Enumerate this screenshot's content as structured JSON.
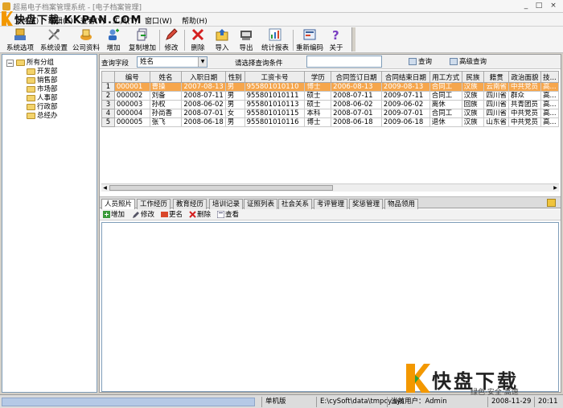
{
  "window": {
    "title": "超易电子档案管理系统 - [电子档案管理]",
    "controls": [
      "_",
      "□",
      "×"
    ]
  },
  "watermark": "快盘下载 KKPAN.COM",
  "menu": [
    "文件(F)",
    "编辑(E)",
    "查看(V)",
    "工具(T)",
    "窗口(W)",
    "帮助(H)"
  ],
  "toolbar": [
    {
      "label": "系统选项",
      "icon": "system-options-icon"
    },
    {
      "label": "系统设置",
      "icon": "tools-icon"
    },
    {
      "label": "公司资料",
      "icon": "company-icon"
    },
    {
      "label": "增加",
      "icon": "add-icon"
    },
    {
      "label": "复制增加",
      "icon": "copy-add-icon"
    },
    {
      "label": "修改",
      "icon": "edit-icon"
    },
    {
      "label": "删除",
      "icon": "delete-icon"
    },
    {
      "label": "导入",
      "icon": "import-icon"
    },
    {
      "label": "导出",
      "icon": "export-icon"
    },
    {
      "label": "统计报表",
      "icon": "report-icon"
    },
    {
      "label": "重新编码",
      "icon": "recode-icon"
    },
    {
      "label": "关于",
      "icon": "help-icon"
    }
  ],
  "tree": {
    "root": "所有分组",
    "children": [
      "开发部",
      "销售部",
      "市场部",
      "人事部",
      "行政部",
      "总经办"
    ]
  },
  "search": {
    "field_label": "查询字段",
    "field_value": "姓名",
    "condition_label": "请选择查询条件",
    "input_value": "",
    "query_button": "查询",
    "advanced_button": "高级查询"
  },
  "grid": {
    "columns": [
      "编号",
      "姓名",
      "入职日期",
      "性别",
      "工资卡号",
      "学历",
      "合同签订日期",
      "合同结束日期",
      "用工方式",
      "民族",
      "籍贯",
      "政治面貌",
      "技..."
    ],
    "rows": [
      {
        "num": "1",
        "cells": [
          "000001",
          "曹操",
          "2007-08-13",
          "男",
          "955801010110",
          "博士",
          "2006-08-13",
          "2009-08-13",
          "合同工",
          "汉族",
          "云南省",
          "中共党员",
          "高..."
        ],
        "selected": true
      },
      {
        "num": "2",
        "cells": [
          "000002",
          "刘备",
          "2008-07-11",
          "男",
          "955801010111",
          "硕士",
          "2008-07-11",
          "2009-07-11",
          "合同工",
          "汉族",
          "四川省",
          "群众",
          "高..."
        ],
        "selected": false
      },
      {
        "num": "3",
        "cells": [
          "000003",
          "孙权",
          "2008-06-02",
          "男",
          "955801010113",
          "硕士",
          "2008-06-02",
          "2009-06-02",
          "离休",
          "回族",
          "四川省",
          "共青团员",
          "高..."
        ],
        "selected": false
      },
      {
        "num": "4",
        "cells": [
          "000004",
          "孙尚香",
          "2008-07-01",
          "女",
          "955801010115",
          "本科",
          "2008-07-01",
          "2009-07-01",
          "合同工",
          "汉族",
          "四川省",
          "中共党员",
          "高..."
        ],
        "selected": false
      },
      {
        "num": "5",
        "cells": [
          "000005",
          "张飞",
          "2008-06-18",
          "男",
          "955801010116",
          "博士",
          "2008-06-18",
          "2009-06-18",
          "退休",
          "汉族",
          "山东省",
          "中共党员",
          "高..."
        ],
        "selected": false
      }
    ]
  },
  "tabs": [
    "人员照片",
    "工作经历",
    "教育经历",
    "培训记录",
    "证照列表",
    "社会关系",
    "考评管理",
    "奖惩管理",
    "物品领用"
  ],
  "active_tab": "人员照片",
  "subtoolbar": [
    "增加",
    "修改",
    "更名",
    "删除",
    "查看"
  ],
  "status": {
    "mode": "单机版",
    "path": "E:\\cySoft\\data\\tmpcy.sys",
    "user": "当前用户：Admin",
    "date": "2008-11-29",
    "time": "20:11"
  },
  "logo": {
    "text": "快盘下载",
    "slogan": "绿色·安全·高速"
  },
  "colors": {
    "selection": "#f6a64c",
    "accent": "#f39800"
  }
}
